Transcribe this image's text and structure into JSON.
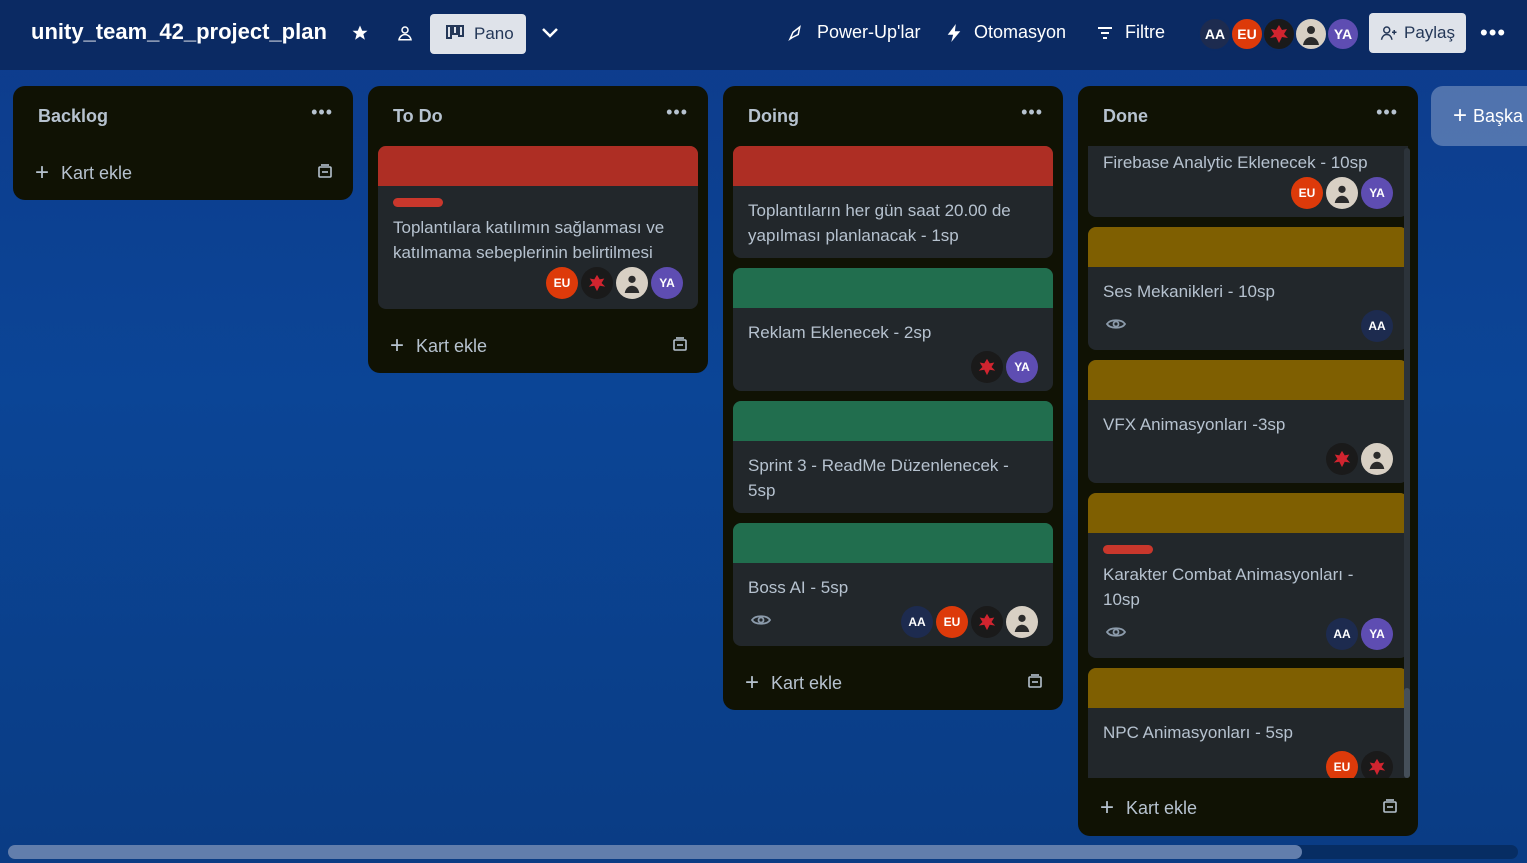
{
  "board": {
    "title": "unity_team_42_project_plan",
    "view_label": "Pano",
    "powerups_label": "Power-Up'lar",
    "automation_label": "Otomasyon",
    "filter_label": "Filtre",
    "share_label": "Paylaş",
    "add_list_label": "Başka",
    "members": [
      "AA",
      "EU",
      "",
      "",
      "YA"
    ]
  },
  "add_card_label": "Kart ekle",
  "lists": [
    {
      "title": "Backlog",
      "cards": []
    },
    {
      "title": "To Do",
      "cards": [
        {
          "cover": "red",
          "label": true,
          "title": "Toplantılara katılımın sağlanması ve katılmama sebeplerinin belirtilmesi",
          "members": [
            "EU",
            "dragon",
            "photo",
            "YA"
          ]
        }
      ]
    },
    {
      "title": "Doing",
      "cards": [
        {
          "cover": "red",
          "title": "Toplantıların her gün saat 20.00 de yapılması planlanacak - 1sp",
          "members": []
        },
        {
          "cover": "green",
          "title": "Reklam Eklenecek - 2sp",
          "members": [
            "dragon",
            "YA"
          ]
        },
        {
          "cover": "green",
          "title": "Sprint 3 - ReadMe Düzenlenecek - 5sp",
          "members": []
        },
        {
          "cover": "green",
          "title": "Boss AI - 5sp",
          "watch": true,
          "members": [
            "AA",
            "EU",
            "dragon",
            "photo"
          ]
        }
      ]
    },
    {
      "title": "Done",
      "cards": [
        {
          "cover": "none",
          "title": "Firebase Analytic Eklenecek - 10sp",
          "members": [
            "EU",
            "photo",
            "YA"
          ]
        },
        {
          "cover": "olive",
          "title": "Ses Mekanikleri - 10sp",
          "watch": true,
          "members": [
            "AA"
          ]
        },
        {
          "cover": "olive",
          "title": "VFX Animasyonları -3sp",
          "members": [
            "dragon",
            "photo"
          ]
        },
        {
          "cover": "olive",
          "label": true,
          "title": "Karakter Combat Animasyonları - 10sp",
          "watch": true,
          "members": [
            "AA",
            "YA"
          ]
        },
        {
          "cover": "olive",
          "title": "NPC Animasyonları - 5sp",
          "members": [
            "EU",
            "dragon"
          ]
        }
      ]
    }
  ]
}
